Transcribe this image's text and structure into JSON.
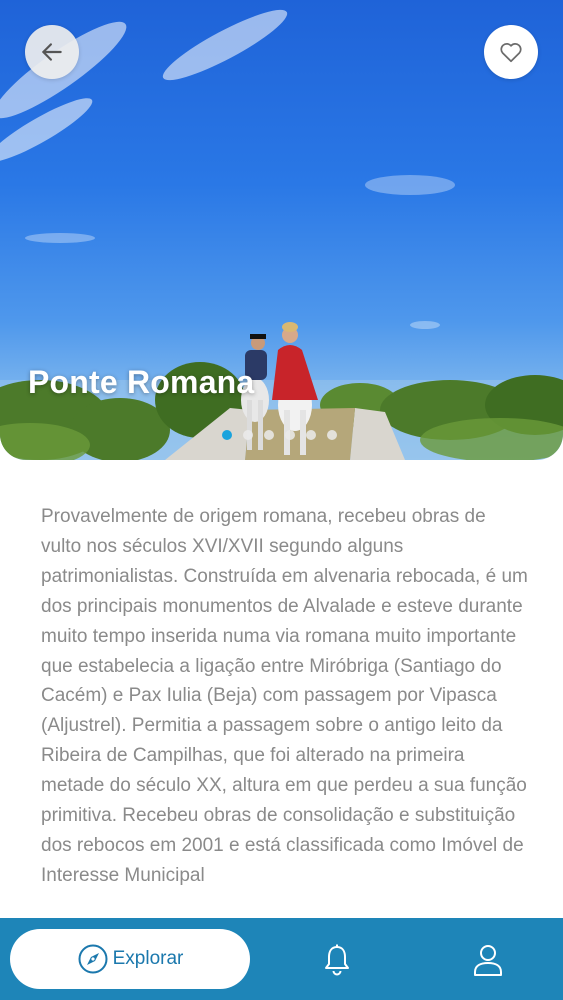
{
  "hero": {
    "title": "Ponte Romana",
    "gallery_count": 6,
    "active_index": 0,
    "colors": {
      "active_dot": "#1aa3dd",
      "sky": "#2a78e6"
    }
  },
  "description": "Provavelmente de origem romana, recebeu obras de vulto nos séculos XVI/XVII segundo alguns patrimonialistas. Construída em alvenaria rebocada, é um dos principais monumentos de Alvalade e esteve durante muito tempo inserida numa via romana muito importante que estabelecia a ligação entre Miróbriga (Santiago do Cacém) e Pax Iulia (Beja) com passagem por Vipasca (Aljustrel). Permitia a passagem sobre o antigo leito da Ribeira de Campilhas, que foi alterado na primeira metade do século XX, altura em que perdeu a sua função primitiva. Recebeu obras de consolidação e substituição dos rebocos em 2001 e está classificada como Imóvel de Interesse Municipal",
  "nav": {
    "explore_label": "Explorar",
    "icons": [
      "compass-icon",
      "bell-icon",
      "user-icon"
    ],
    "colors": {
      "bar": "#1e85b8",
      "accent": "#1b78ad"
    }
  }
}
